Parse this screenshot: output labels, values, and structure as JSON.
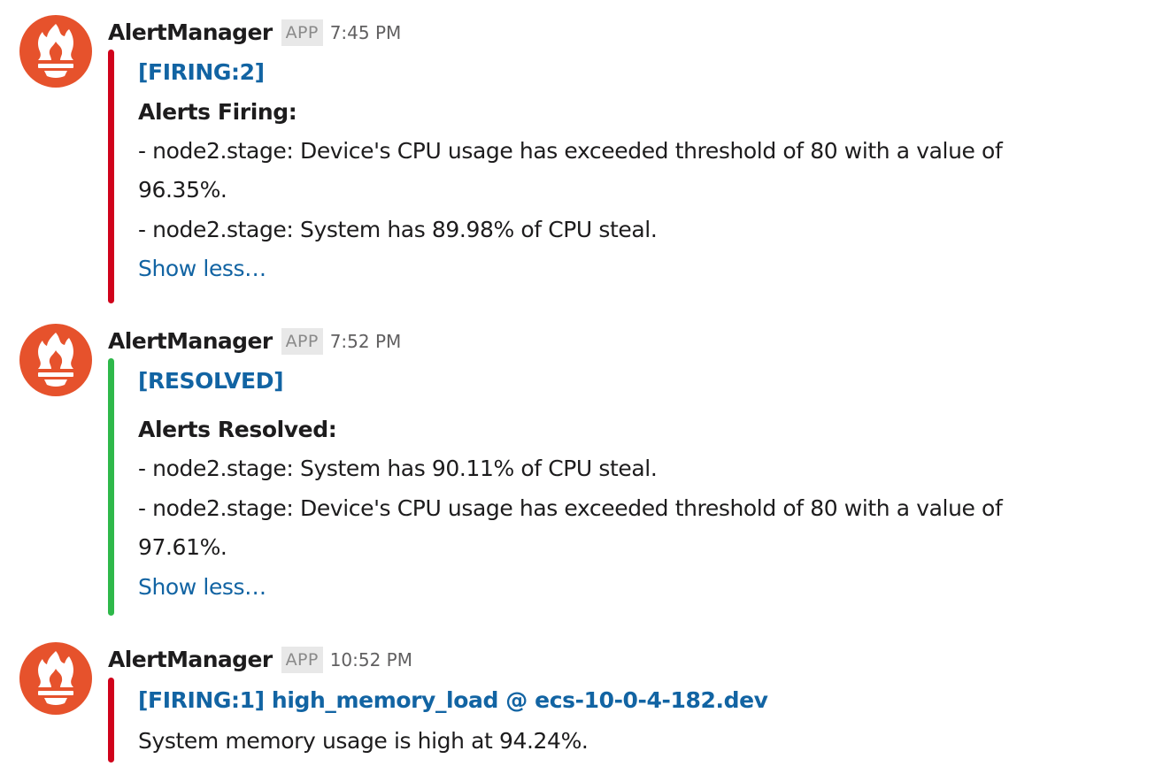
{
  "colors": {
    "firing": "#d0021b",
    "resolved": "#2eb84a",
    "link": "#1264a3",
    "avatar": "#e6522c"
  },
  "messages": [
    {
      "sender": "AlertManager",
      "badge": "APP",
      "time": "7:45 PM",
      "status": "firing",
      "avatar_icon": "prometheus-torch-icon",
      "title": "[FIRING:2]",
      "heading": "Alerts Firing:",
      "lines": [
        "- node2.stage: Device's CPU usage has exceeded threshold of 80 with a value of",
        "96.35%.",
        "- node2.stage: System has 89.98% of CPU steal."
      ],
      "show_less": "Show less…"
    },
    {
      "sender": "AlertManager",
      "badge": "APP",
      "time": "7:52 PM",
      "status": "resolved",
      "avatar_icon": "prometheus-torch-icon",
      "title": "[RESOLVED]",
      "heading": "Alerts Resolved:",
      "lines": [
        "- node2.stage: System has 90.11% of CPU steal.",
        "- node2.stage: Device's CPU usage has exceeded threshold of 80 with a value of",
        "97.61%."
      ],
      "show_less": "Show less…"
    },
    {
      "sender": "AlertManager",
      "badge": "APP",
      "time": "10:52 PM",
      "status": "firing",
      "avatar_icon": "prometheus-torch-icon",
      "title": "[FIRING:1] high_memory_load @ ecs-10-0-4-182.dev",
      "lines": [
        "System memory usage is high at 94.24%."
      ]
    }
  ]
}
